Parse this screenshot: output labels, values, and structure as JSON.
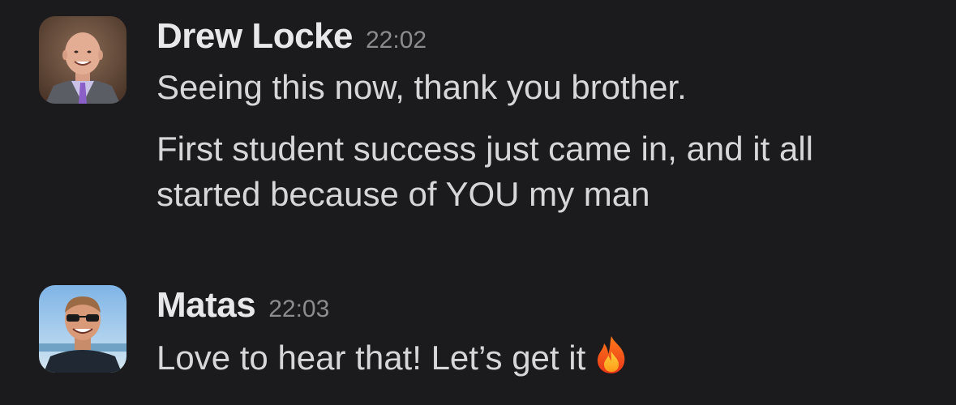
{
  "messages": [
    {
      "author": "Drew Locke",
      "time": "22:02",
      "paragraphs": [
        "Seeing this now, thank you brother.",
        "First student success just came in, and it all started because of YOU my man"
      ]
    },
    {
      "author": "Matas",
      "time": "22:03",
      "paragraphs": [
        "Love to hear that! Let’s get it"
      ],
      "emoji": "fire-emoji"
    }
  ],
  "colors": {
    "background": "#1b1b1d",
    "author": "#e8e8ea",
    "text": "#d7d7d9",
    "timestamp": "#8c8c90"
  }
}
